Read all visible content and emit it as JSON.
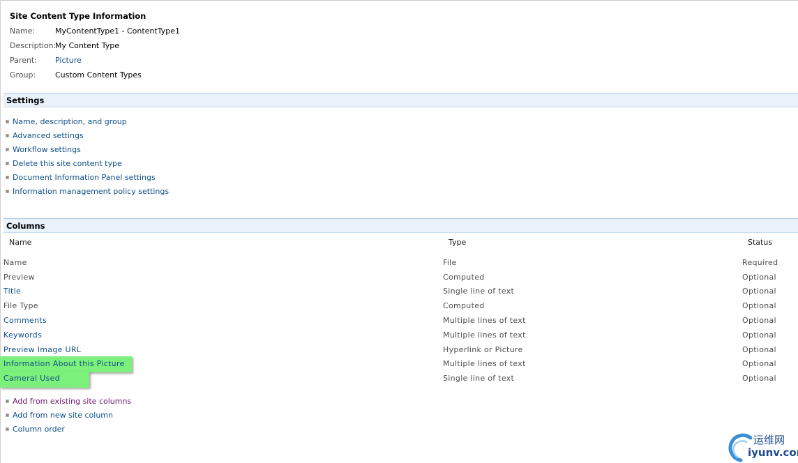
{
  "header": {
    "title": "Site Content Type Information",
    "fields": [
      {
        "label": "Name:",
        "value": "MyContentType1 - ContentType1"
      },
      {
        "label": "Description:",
        "value": "My Content Type"
      },
      {
        "label": "Parent:",
        "value": "Picture"
      },
      {
        "label": "Group:",
        "value": "Custom Content Types"
      }
    ]
  },
  "settings": {
    "title": "Settings",
    "links": [
      "Name, description, and group",
      "Advanced settings",
      "Workflow settings",
      "Delete this site content type",
      "Document Information Panel settings",
      "Information management policy settings"
    ]
  },
  "columns": {
    "title": "Columns",
    "headers": {
      "name": "Name",
      "type": "Type",
      "status": "Status"
    },
    "rows": [
      {
        "name": "Name",
        "type": "File",
        "status": "Required",
        "link": false
      },
      {
        "name": "Preview",
        "type": "Computed",
        "status": "Optional",
        "link": false
      },
      {
        "name": "Title",
        "type": "Single line of text",
        "status": "Optional",
        "link": true
      },
      {
        "name": "File Type",
        "type": "Computed",
        "status": "Optional",
        "link": false
      },
      {
        "name": "Comments",
        "type": "Multiple lines of text",
        "status": "Optional",
        "link": true
      },
      {
        "name": "Keywords",
        "type": "Multiple lines of text",
        "status": "Optional",
        "link": true
      },
      {
        "name": "Preview Image URL",
        "type": "Hyperlink or Picture",
        "status": "Optional",
        "link": true
      },
      {
        "name": "Information About this Picture",
        "type": "Multiple lines of text",
        "status": "Optional",
        "link": true
      },
      {
        "name": "Cameral Used",
        "type": "Single line of text",
        "status": "Optional",
        "link": true
      }
    ],
    "actions": [
      "Add from existing site columns",
      "Add from new site column",
      "Column order"
    ]
  },
  "watermark": {
    "cn": "运维网",
    "en": "iyunv.com"
  },
  "colors": {
    "link": "#0f4e88",
    "visited": "#6b1a6b",
    "highlight": "#7bf17b",
    "section_bg": "#eaf2fb"
  }
}
